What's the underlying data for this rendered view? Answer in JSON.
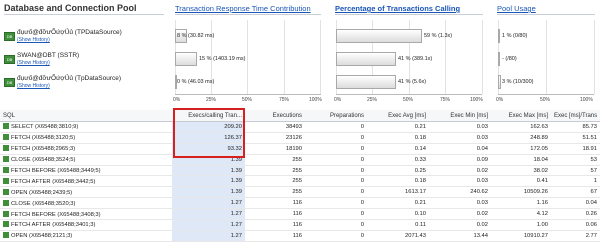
{
  "header": {
    "title": "Database and Connection Pool",
    "col_links": [
      "Transaction Response Time Contribution",
      "Percentage of Transactions Calling",
      "Pool Usage"
    ]
  },
  "datasources": [
    {
      "name": "đụưố@đỡưỐứợỦủ (TPDataSource)",
      "history_label": "(Show History)",
      "trt_label": "8 % (30.82 ms)",
      "trt_pct": 8,
      "calling_label": "59 % (1.3x)",
      "calling_pct": 59,
      "pool_label": "1 % (0/80)",
      "pool_pct": 1
    },
    {
      "name": "SWAN@DBT (SSTR)",
      "history_label": "(Show History)",
      "trt_label": "15 % (1403.19 ms)",
      "trt_pct": 15,
      "calling_label": "41 % (389.1x)",
      "calling_pct": 41,
      "pool_label": "- (/80)",
      "pool_pct": 0
    },
    {
      "name": "đụưố@đỡưỐứợỦủ (TpDataSource)",
      "history_label": "(Show History)",
      "trt_label": "0 % (46.03 ms)",
      "trt_pct": 0,
      "calling_label": "41 % (5.6x)",
      "calling_pct": 41,
      "pool_label": "3 % (10/300)",
      "pool_pct": 3
    }
  ],
  "axes": {
    "trt_ticks": [
      "0%",
      "25%",
      "50%",
      "75%",
      "100%"
    ],
    "calling_ticks": [
      "0%",
      "25%",
      "50%",
      "75%",
      "100%"
    ],
    "pool_ticks": [
      "0%",
      "50%",
      "100%"
    ]
  },
  "table": {
    "columns": [
      "SQL",
      "Execs/calling Tran...",
      "Executions",
      "Preparations",
      "Exec Avg [ms]",
      "Exec Min [ms]",
      "Exec Max [ms]",
      "Exec [ms]/Trans"
    ],
    "rows": [
      [
        "SELECT (X65488;3810;9)",
        "209.20",
        "38493",
        "0",
        "0.21",
        "0.03",
        "162.63",
        "85.73"
      ],
      [
        "FETCH (X65488;3120;5)",
        "126.37",
        "23126",
        "0",
        "0.18",
        "0.03",
        "248.89",
        "51.51"
      ],
      [
        "FETCH (X65488;2965;3)",
        "93.32",
        "18190",
        "0",
        "0.14",
        "0.04",
        "172.05",
        "18.91"
      ],
      [
        "CLOSE (X65488;3524;5)",
        "1.39",
        "255",
        "0",
        "0.33",
        "0.09",
        "18.04",
        "53"
      ],
      [
        "FETCH BEFORE (X65488;3449;5)",
        "1.39",
        "255",
        "0",
        "0.25",
        "0.02",
        "38.02",
        "57"
      ],
      [
        "FETCH AFTER (X65488;3442;5)",
        "1.39",
        "255",
        "0",
        "0.18",
        "0.03",
        "0.41",
        "1"
      ],
      [
        "OPEN (X65488;2439;5)",
        "1.39",
        "255",
        "0",
        "1613.17",
        "240.62",
        "10509.26",
        "67"
      ],
      [
        "CLOSE (X65488;3520;3)",
        "1.27",
        "116",
        "0",
        "0.21",
        "0.03",
        "1.16",
        "0.04"
      ],
      [
        "FETCH BEFORE (X65488;3408;3)",
        "1.27",
        "116",
        "0",
        "0.10",
        "0.02",
        "4.12",
        "0.26"
      ],
      [
        "FETCH AFTER (X65488;3401;3)",
        "1.27",
        "116",
        "0",
        "0.11",
        "0.02",
        "1.00",
        "0.06"
      ],
      [
        "OPEN (X65488;2121;3)",
        "1.27",
        "116",
        "0",
        "2071.43",
        "13.44",
        "10910.27",
        "2.77"
      ]
    ]
  },
  "colors": {
    "link": "#1a56b8",
    "highlight_box": "#d61f1f",
    "icon_green": "#3e8e3a"
  }
}
